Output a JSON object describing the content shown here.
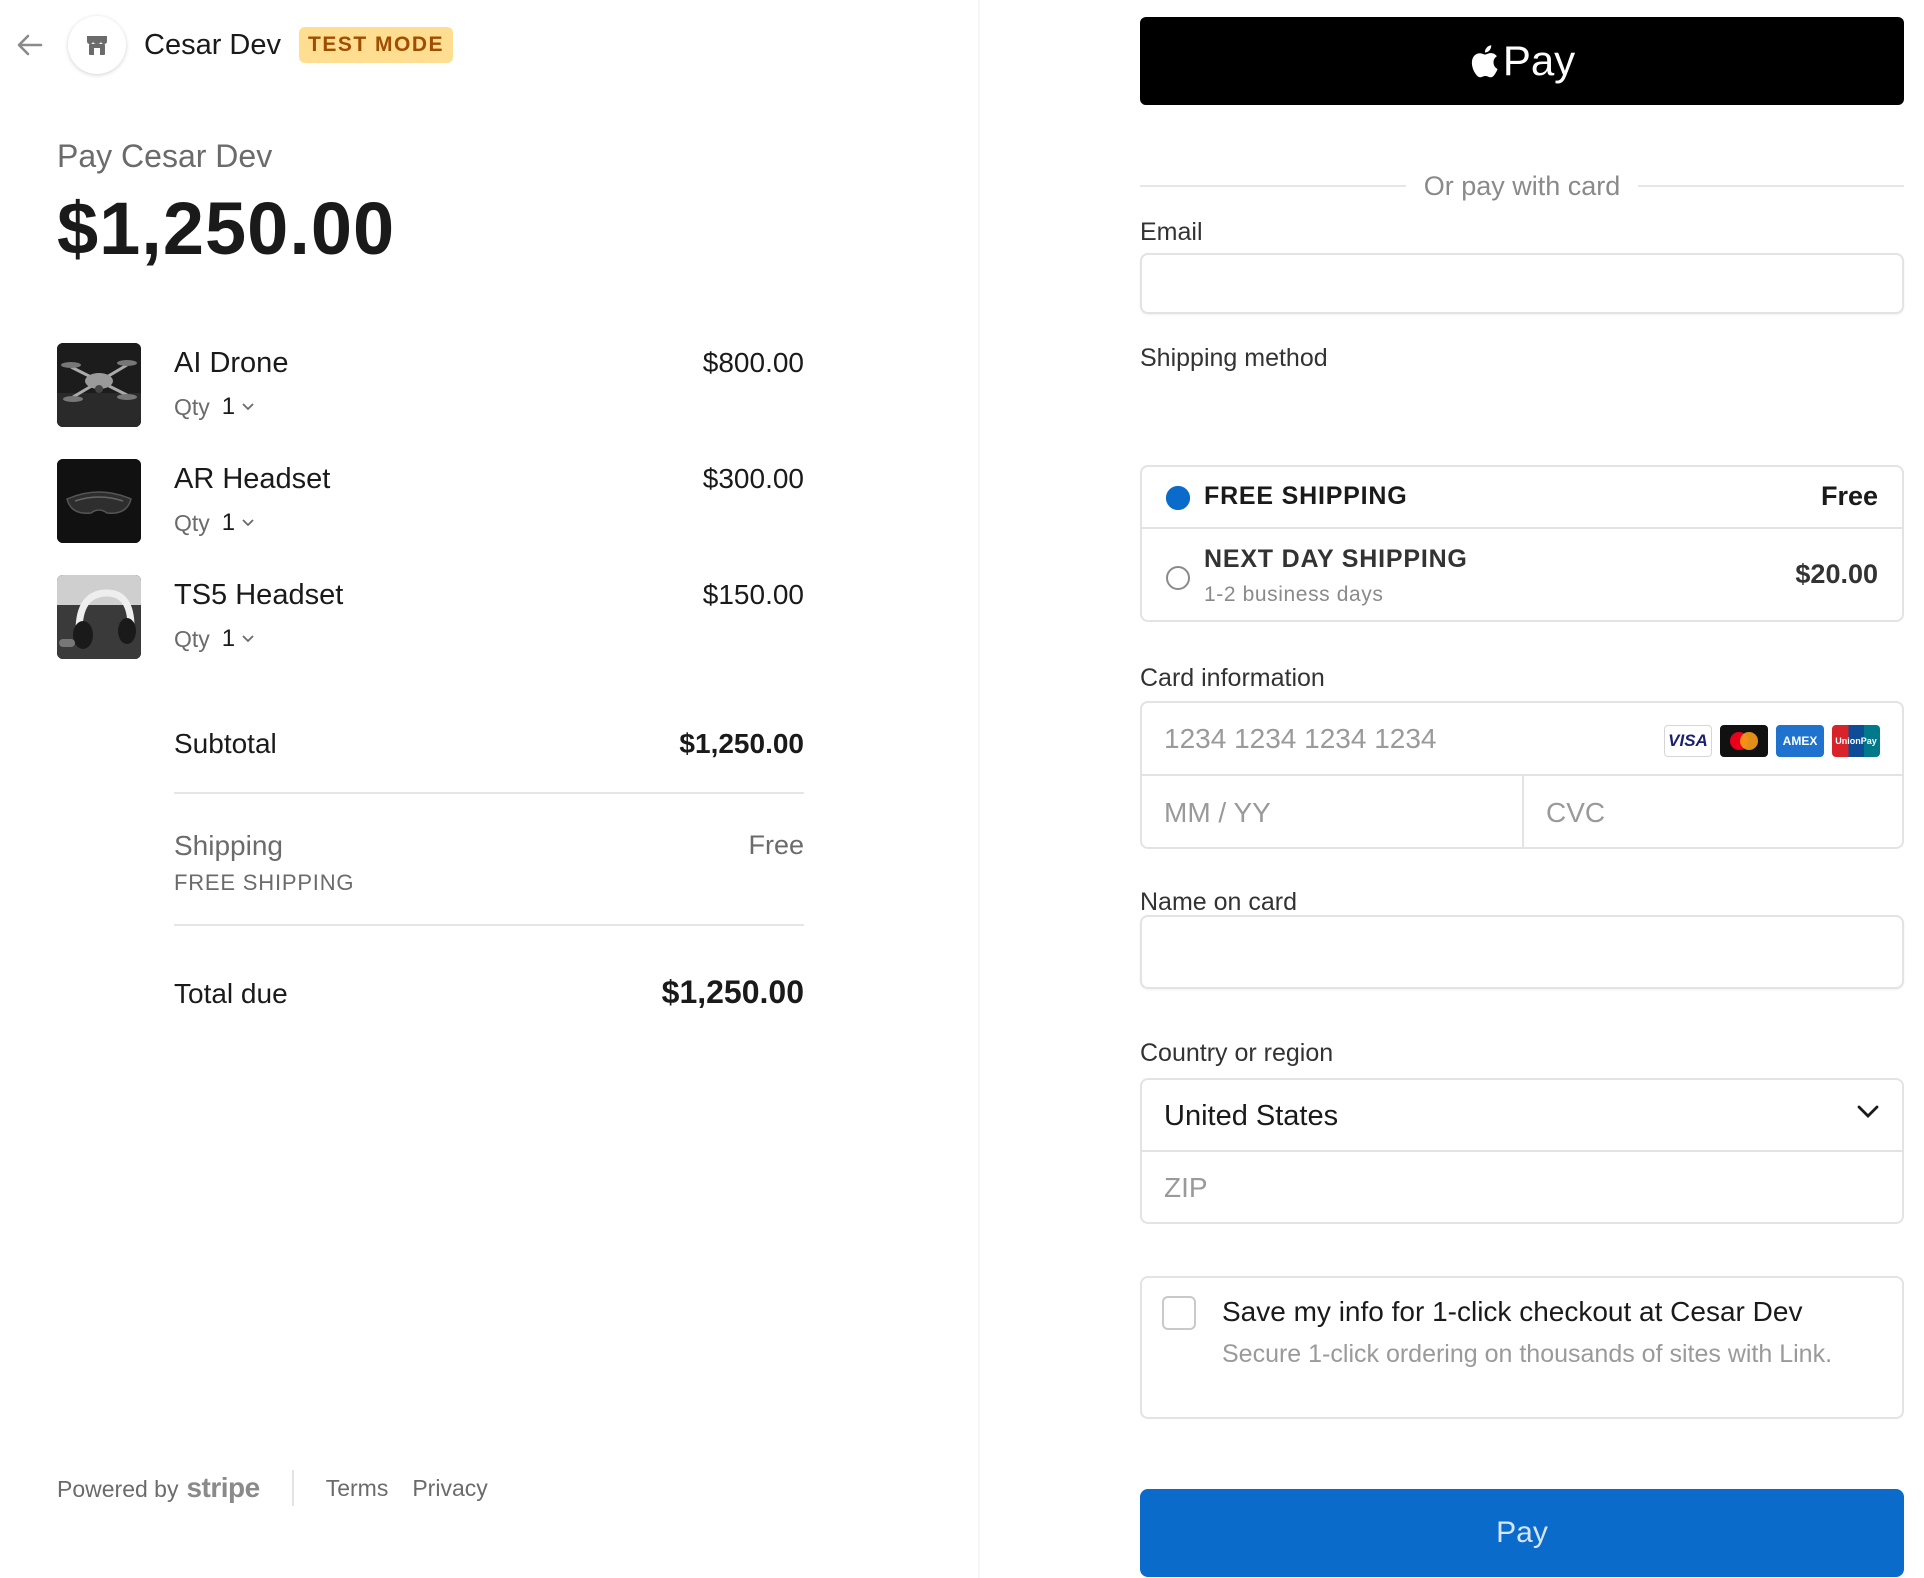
{
  "header": {
    "merchant_name": "Cesar Dev",
    "badge": "TEST MODE"
  },
  "summary_header": {
    "pay_label": "Pay Cesar Dev",
    "amount": "$1,250.00"
  },
  "line_items": [
    {
      "name": "AI Drone",
      "qty_label": "Qty",
      "qty": "1",
      "price": "$800.00"
    },
    {
      "name": "AR Headset",
      "qty_label": "Qty",
      "qty": "1",
      "price": "$300.00"
    },
    {
      "name": "TS5 Headset",
      "qty_label": "Qty",
      "qty": "1",
      "price": "$150.00"
    }
  ],
  "totals": {
    "subtotal_label": "Subtotal",
    "subtotal_value": "$1,250.00",
    "shipping_label": "Shipping",
    "shipping_method": "FREE SHIPPING",
    "shipping_value": "Free",
    "total_label": "Total due",
    "total_value": "$1,250.00"
  },
  "footer": {
    "powered_by": "Powered by",
    "stripe": "stripe",
    "terms": "Terms",
    "privacy": "Privacy"
  },
  "payment": {
    "apple_pay_label": "Pay",
    "divider_text": "Or pay with card",
    "email_label": "Email",
    "email_value": "",
    "shipping_method_label": "Shipping method",
    "shipping_options": [
      {
        "name": "FREE SHIPPING",
        "detail": "",
        "price": "Free",
        "selected": true
      },
      {
        "name": "NEXT DAY SHIPPING",
        "detail": "1-2 business days",
        "price": "$20.00",
        "selected": false
      }
    ],
    "card_label": "Card information",
    "card_number_placeholder": "1234 1234 1234 1234",
    "card_brands": [
      "VISA",
      "Mastercard",
      "AMEX",
      "UnionPay"
    ],
    "expiry_placeholder": "MM / YY",
    "cvc_placeholder": "CVC",
    "name_label": "Name on card",
    "name_value": "",
    "country_label": "Country or region",
    "country_value": "United States",
    "zip_placeholder": "ZIP",
    "save_title": "Save my info for 1-click checkout at Cesar Dev",
    "save_subtitle": "Secure 1-click ordering on thousands of sites with Link.",
    "save_checked": false,
    "pay_button": "Pay"
  },
  "colors": {
    "accent": "#0b6bcb",
    "badge_bg": "#ffde92",
    "badge_text": "#a04d00",
    "apple_pay_bg": "#000000"
  }
}
